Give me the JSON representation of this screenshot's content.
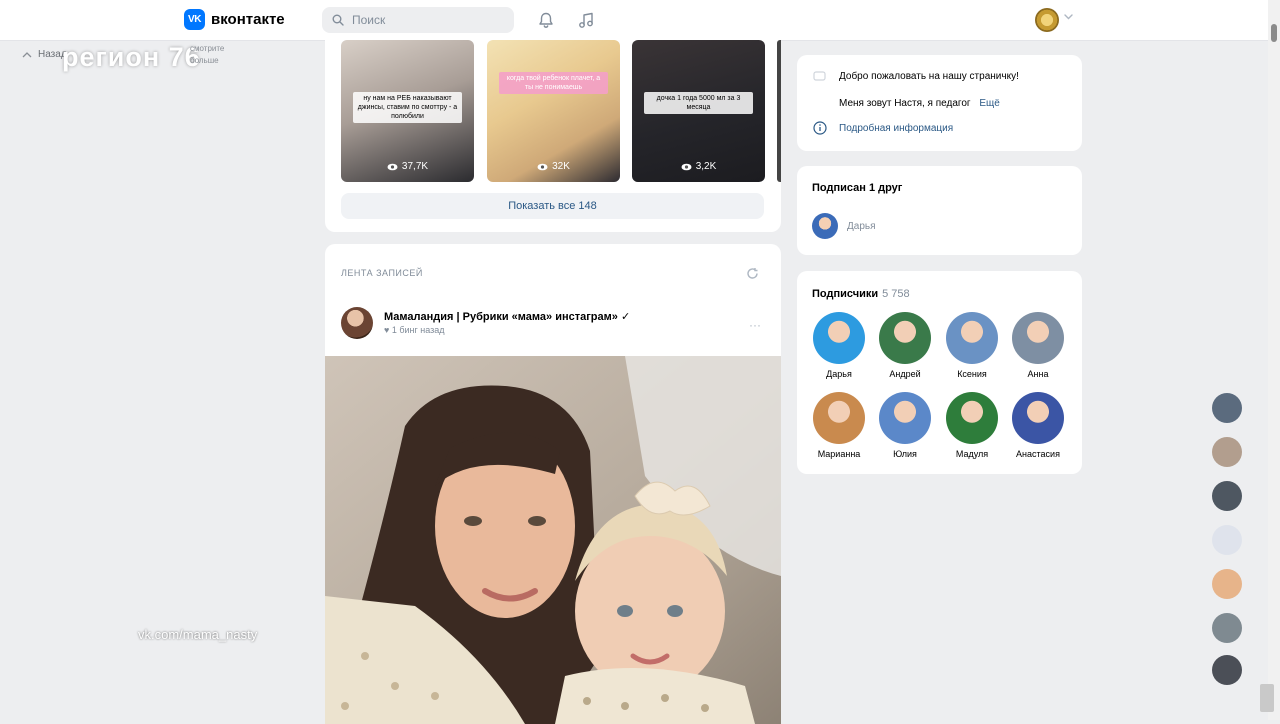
{
  "header": {
    "logo_mark": "VK",
    "logo_text": "вконтакте",
    "search_placeholder": "Поиск"
  },
  "watermark": {
    "back_label": "Назад",
    "logo": "регион 76",
    "sub_line1": "смотрите",
    "sub_line2": "больше",
    "source_url": "vk.com/mama_nasty"
  },
  "clips": {
    "items": [
      {
        "caption": "ну нам на РЕБ наказывают джинсы, ставим по смоттру - а полюбили",
        "views": "37,7K"
      },
      {
        "caption": "когда твой ребенок плачет, а ты не понимаешь",
        "views": "32K"
      },
      {
        "caption": "дочка 1 года 5000 мл за 3 месяца",
        "views": "3,2K"
      }
    ],
    "show_all_label": "Показать все 148"
  },
  "feed": {
    "tab_label": "ЛЕНТА ЗАПИСЕЙ",
    "post": {
      "author": "Мамаландия | Рубрики «мама» инстаграм» ✓",
      "time": "♥ 1 бинг назад",
      "more": "···"
    }
  },
  "profile_info": {
    "line1": "Добро пожаловать на нашу страничку!",
    "line2": "Меня зовут Настя, я педагог",
    "line2_link": "Ещё",
    "details_link": "Подробная информация"
  },
  "friends": {
    "title": "Подписан 1 друг",
    "friend_name": "Дарья"
  },
  "subscribers": {
    "title": "Подписчики",
    "count": "5 758",
    "people": [
      {
        "name": "Дарья",
        "color": "#2d9be0"
      },
      {
        "name": "Андрей",
        "color": "#3a7a4a"
      },
      {
        "name": "Ксения",
        "color": "#6a92c4"
      },
      {
        "name": "Анна",
        "color": "#7e8fa3"
      },
      {
        "name": "Марианна",
        "color": "#c98a4e"
      },
      {
        "name": "Юлия",
        "color": "#5b88c9"
      },
      {
        "name": "Мадуля",
        "color": "#2e7d3b"
      },
      {
        "name": "Анастасия",
        "color": "#3b55a5"
      }
    ]
  },
  "side_strip_colors": [
    "#5b6b7e",
    "#b29e8e",
    "#4e5761",
    "#dfe3ec",
    "#e7b48a",
    "#7f8a91",
    "#4b4f57"
  ]
}
